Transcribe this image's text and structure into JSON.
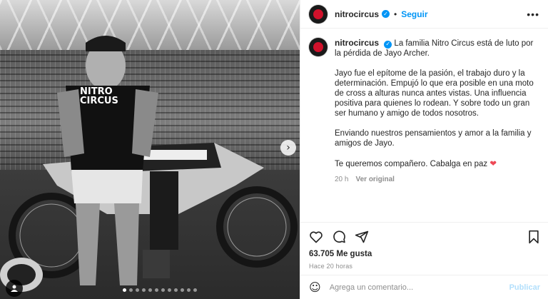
{
  "post": {
    "username": "nitrocircus",
    "separator": "•",
    "follow_label": "Seguir",
    "more_icon": "more-icon",
    "shirt_text": "NITRO CIRCUS",
    "caption": {
      "lead": "La familia Nitro Circus está de luto por la pérdida de Jayo Archer.",
      "paragraph_2": "Jayo fue el epítome de la pasión, el trabajo duro y la determinación. Empujó lo que era posible en una moto de cross a alturas nunca antes vistas. Una influencia positiva para quienes lo rodean. Y sobre todo un gran ser humano y amigo de todos nosotros.",
      "paragraph_3": "Enviando nuestros pensamientos y amor a la familia y amigos de Jayo.",
      "paragraph_4": "Te queremos compañero. Cabalga en paz",
      "heart": "❤"
    },
    "time": "20 h",
    "see_original": "Ver original",
    "likes": "63.705 Me gusta",
    "posted_ago": "Hace 20 horas",
    "comment_placeholder": "Agrega un comentario...",
    "publish_label": "Publicar",
    "carousel": {
      "total": 12,
      "active": 0
    },
    "colors": {
      "accent": "#0095f6",
      "heart": "#ed4956",
      "brand": "#d0112b"
    }
  }
}
